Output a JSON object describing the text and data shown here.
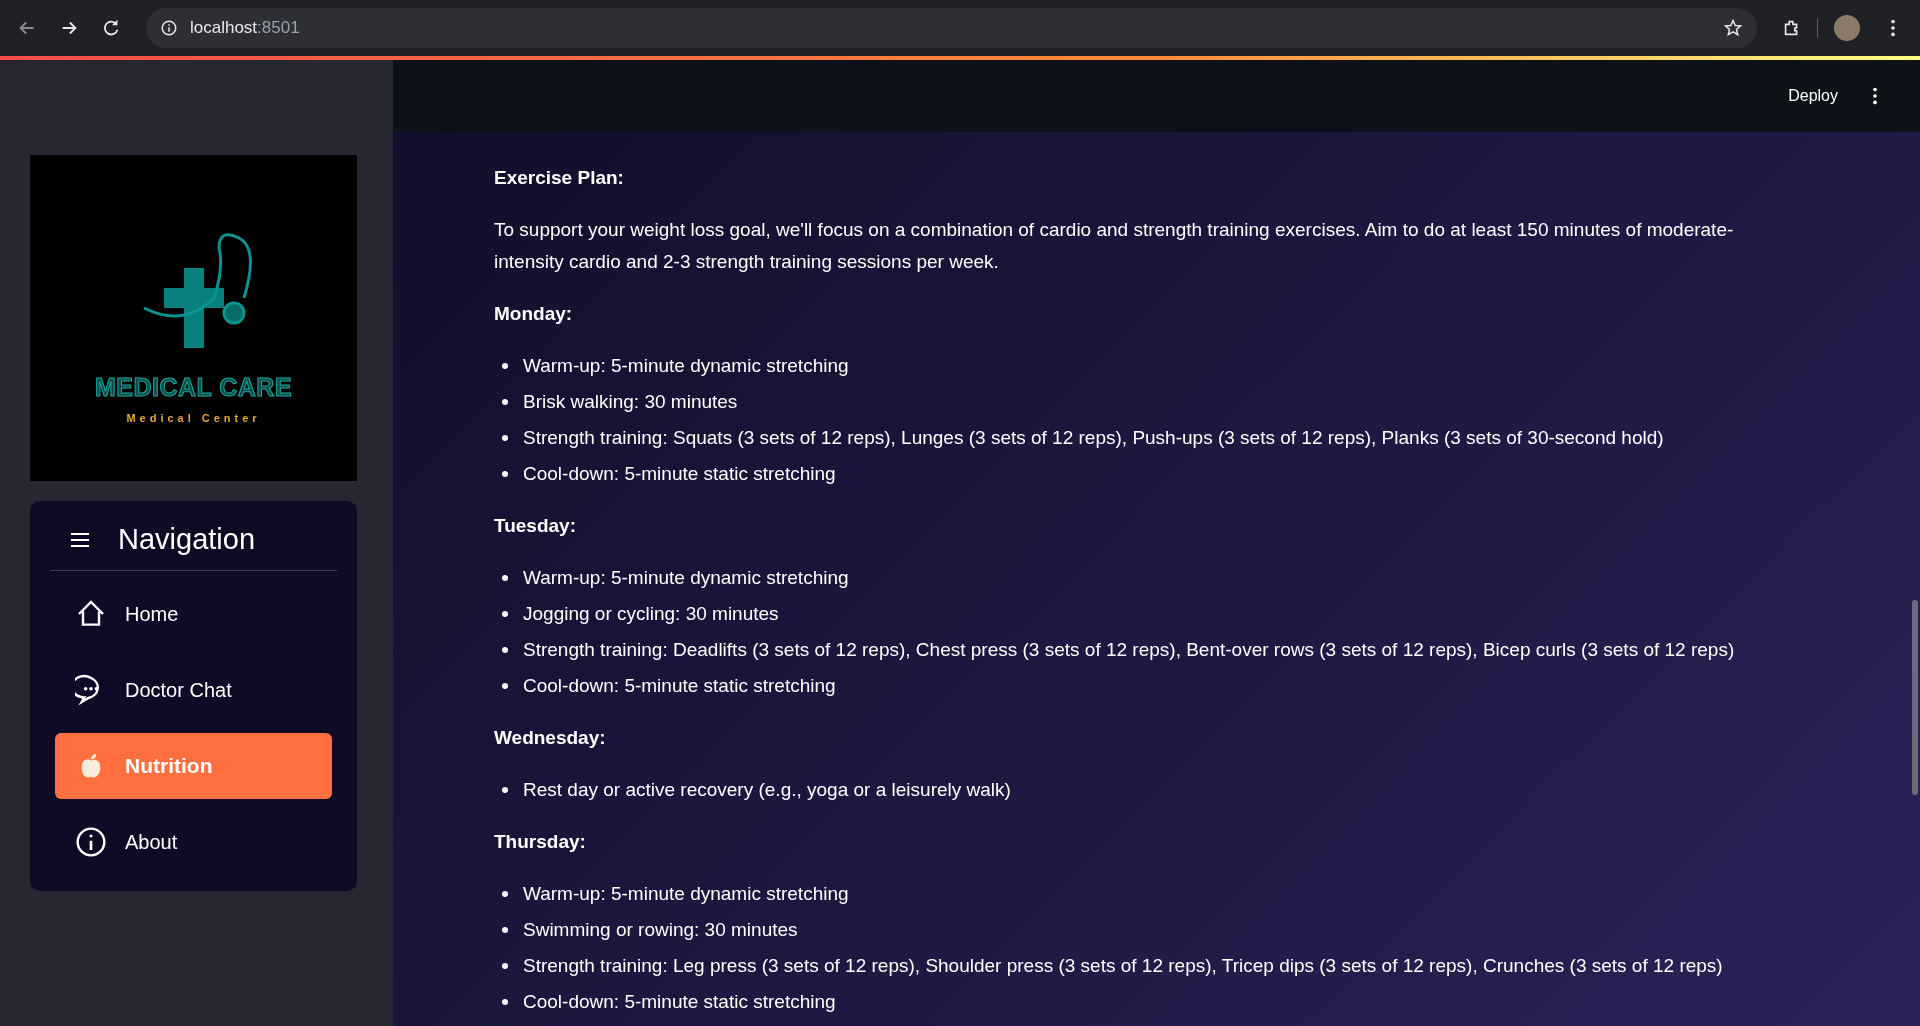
{
  "browser": {
    "url_host": "localhost",
    "url_port": ":8501"
  },
  "header": {
    "deploy_label": "Deploy"
  },
  "sidebar": {
    "logo": {
      "title": "MEDICAL CARE",
      "subtitle": "Medical Center"
    },
    "navigation": {
      "title": "Navigation",
      "items": [
        {
          "label": "Home",
          "kind": "home",
          "selected": false
        },
        {
          "label": "Doctor Chat",
          "kind": "chat",
          "selected": false
        },
        {
          "label": "Nutrition",
          "kind": "apple",
          "selected": true
        },
        {
          "label": "About",
          "kind": "info",
          "selected": false
        }
      ]
    }
  },
  "content": [
    {
      "kind": "heading",
      "text": "Exercise Plan:"
    },
    {
      "kind": "paragraph",
      "text": "To support your weight loss goal, we'll focus on a combination of cardio and strength training exercises. Aim to do at least 150 minutes of moderate-intensity cardio and 2-3 strength training sessions per week."
    },
    {
      "kind": "heading",
      "text": "Monday:"
    },
    {
      "kind": "list",
      "items": [
        "Warm-up: 5-minute dynamic stretching",
        "Brisk walking: 30 minutes",
        "Strength training: Squats (3 sets of 12 reps), Lunges (3 sets of 12 reps), Push-ups (3 sets of 12 reps), Planks (3 sets of 30-second hold)",
        "Cool-down: 5-minute static stretching"
      ]
    },
    {
      "kind": "heading",
      "text": "Tuesday:"
    },
    {
      "kind": "list",
      "items": [
        "Warm-up: 5-minute dynamic stretching",
        "Jogging or cycling: 30 minutes",
        "Strength training: Deadlifts (3 sets of 12 reps), Chest press (3 sets of 12 reps), Bent-over rows (3 sets of 12 reps), Bicep curls (3 sets of 12 reps)",
        "Cool-down: 5-minute static stretching"
      ]
    },
    {
      "kind": "heading",
      "text": "Wednesday:"
    },
    {
      "kind": "list",
      "items": [
        "Rest day or active recovery (e.g., yoga or a leisurely walk)"
      ]
    },
    {
      "kind": "heading",
      "text": "Thursday:"
    },
    {
      "kind": "list",
      "items": [
        "Warm-up: 5-minute dynamic stretching",
        "Swimming or rowing: 30 minutes",
        "Strength training: Leg press (3 sets of 12 reps), Shoulder press (3 sets of 12 reps), Tricep dips (3 sets of 12 reps), Crunches (3 sets of 12 reps)",
        "Cool-down: 5-minute static stretching"
      ]
    }
  ]
}
